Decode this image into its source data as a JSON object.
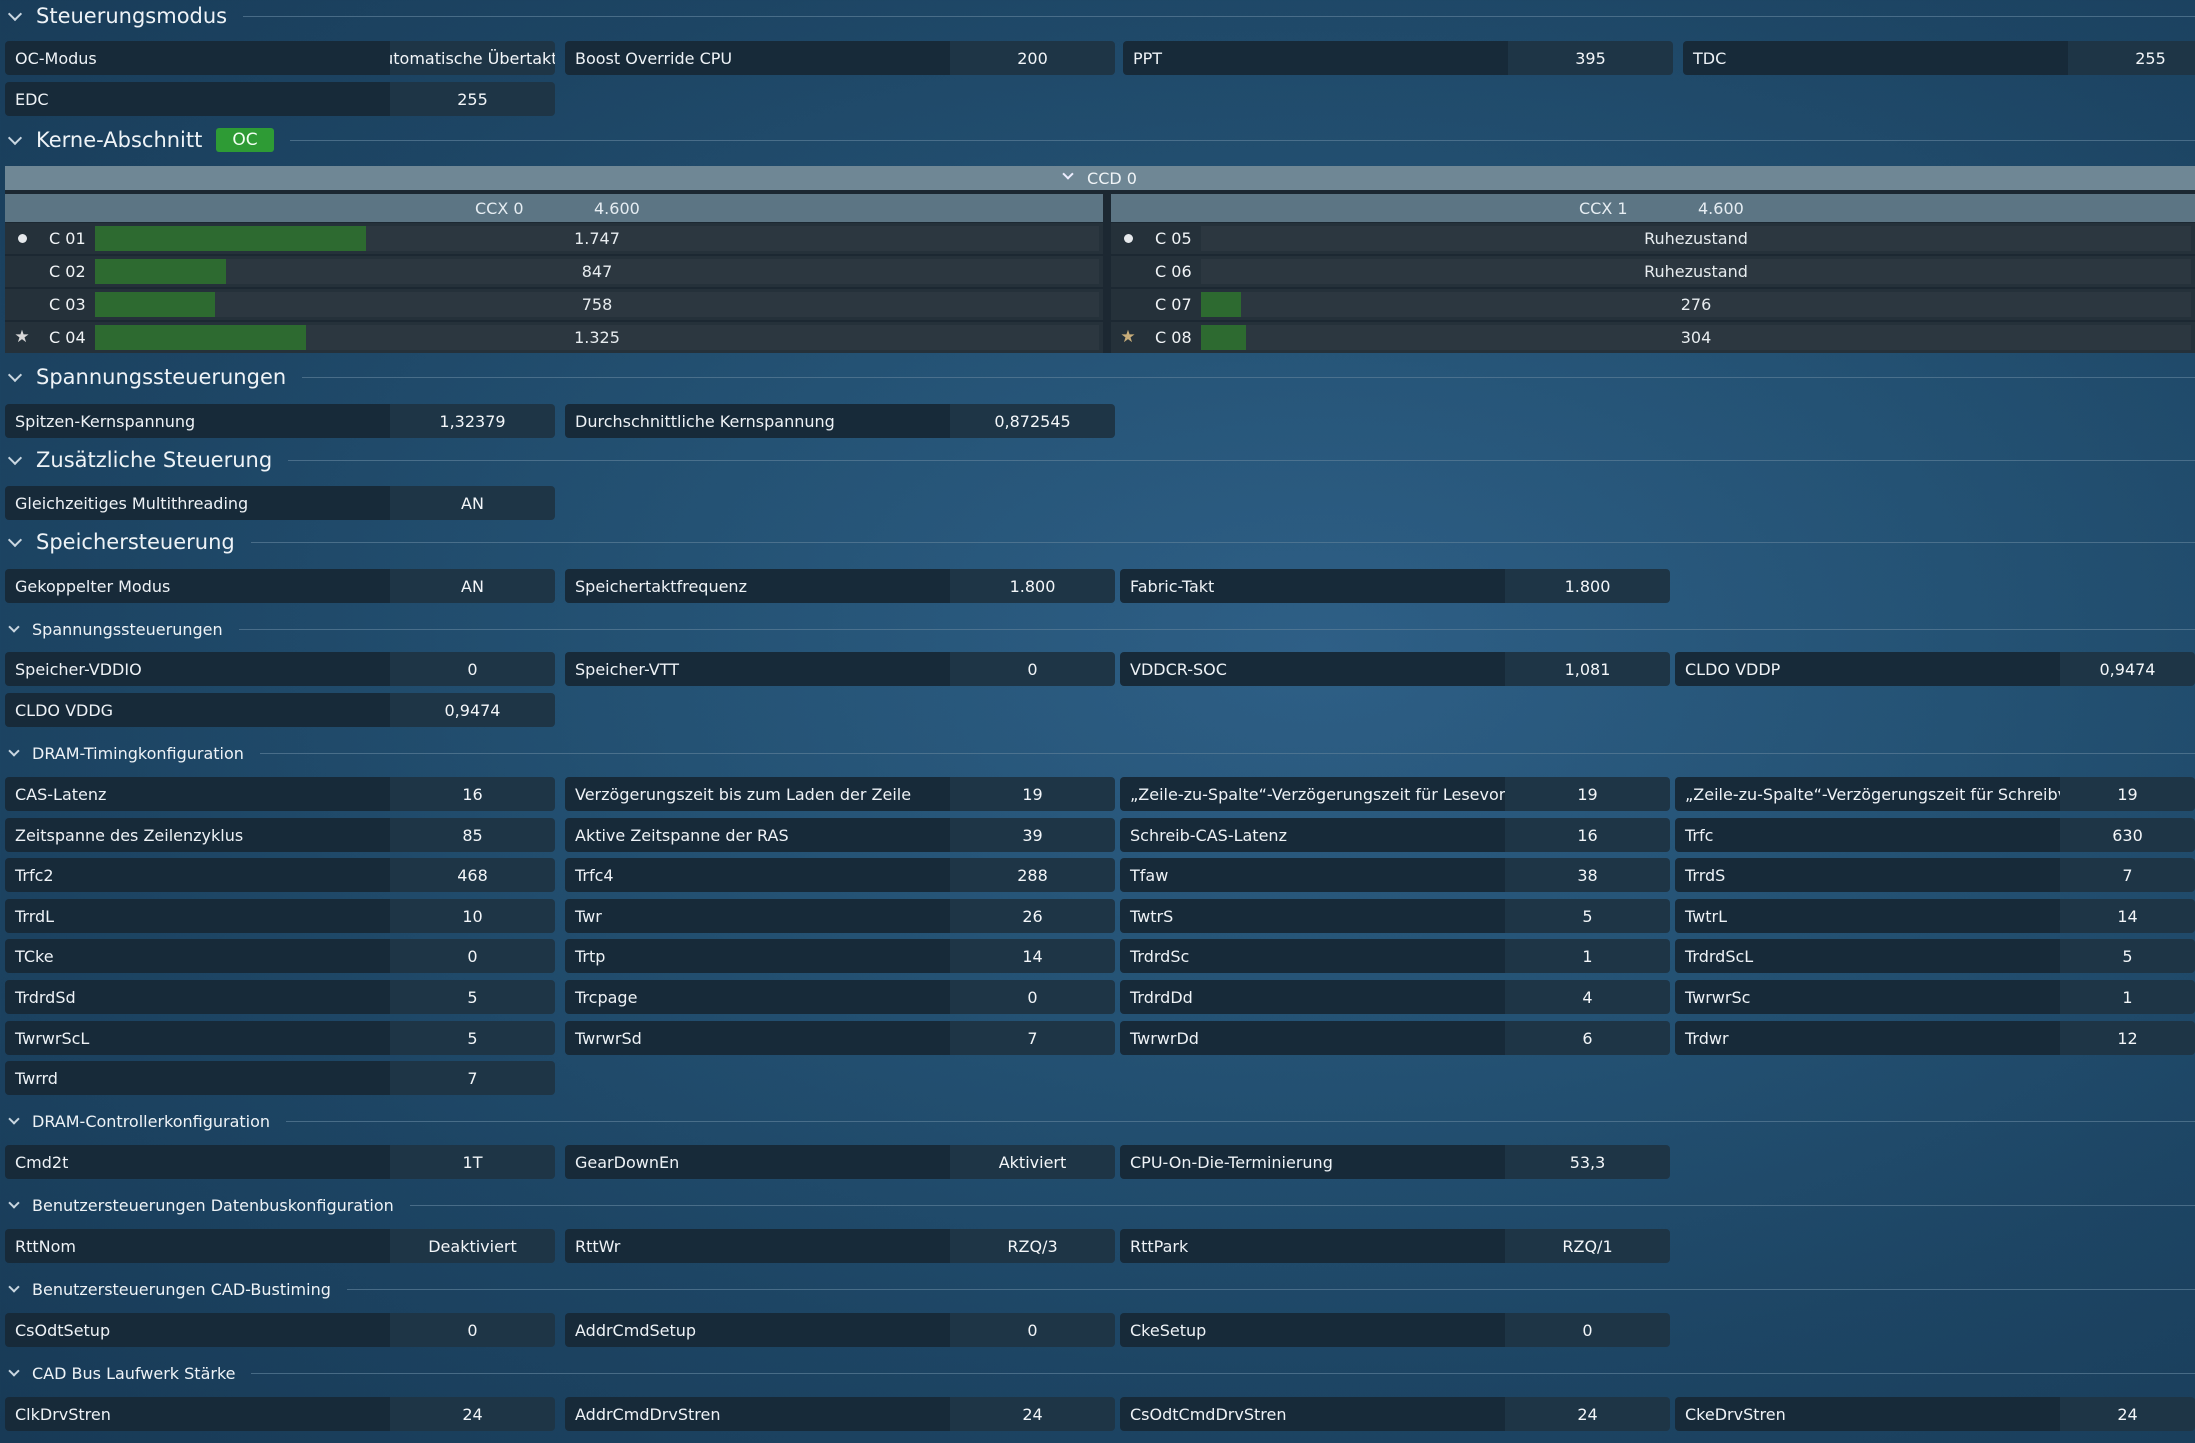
{
  "sections": {
    "steuerungsmodus": "Steuerungsmodus",
    "kerne": "Kerne-Abschnitt",
    "kerne_badge": "OC",
    "spannung": "Spannungssteuerungen",
    "zusaetzlich": "Zusätzliche Steuerung",
    "speicher": "Speichersteuerung",
    "sub_spannung": "Spannungssteuerungen",
    "sub_dram_timing": "DRAM-Timingkonfiguration",
    "sub_dram_ctrl": "DRAM-Controllerkonfiguration",
    "sub_datenbus": "Benutzersteuerungen Datenbuskonfiguration",
    "sub_cad_timing": "Benutzersteuerungen CAD-Bustiming",
    "sub_cad_strength": "CAD Bus Laufwerk Stärke"
  },
  "steuerung": [
    {
      "label": "OC-Modus",
      "value": "Automatische Übertakt..."
    },
    {
      "label": "Boost Override CPU",
      "value": "200"
    },
    {
      "label": "PPT",
      "value": "395"
    },
    {
      "label": "TDC",
      "value": "255"
    },
    {
      "label": "EDC",
      "value": "255"
    }
  ],
  "ccd": {
    "label": "CCD 0",
    "ccx0": {
      "label": "CCX 0",
      "freq": "4.600"
    },
    "ccx1": {
      "label": "CCX 1",
      "freq": "4.600"
    },
    "cores_left": [
      {
        "name": "C 01",
        "value": "1.747",
        "marker": "dot",
        "level": 0.27
      },
      {
        "name": "C 02",
        "value": "847",
        "marker": "none",
        "level": 0.13
      },
      {
        "name": "C 03",
        "value": "758",
        "marker": "none",
        "level": 0.12
      },
      {
        "name": "C 04",
        "value": "1.325",
        "marker": "star",
        "level": 0.21
      }
    ],
    "cores_right": [
      {
        "name": "C 05",
        "value": "Ruhezustand",
        "marker": "dot",
        "level": 0
      },
      {
        "name": "C 06",
        "value": "Ruhezustand",
        "marker": "none",
        "level": 0
      },
      {
        "name": "C 07",
        "value": "276",
        "marker": "none",
        "level": 0.04
      },
      {
        "name": "C 08",
        "value": "304",
        "marker": "star-gold",
        "level": 0.045
      }
    ]
  },
  "spannung": [
    {
      "label": "Spitzen-Kernspannung",
      "value": "1,32379"
    },
    {
      "label": "Durchschnittliche Kernspannung",
      "value": "0,872545"
    }
  ],
  "zusaetzlich": [
    {
      "label": "Gleichzeitiges Multithreading",
      "value": "AN"
    }
  ],
  "speicher": [
    {
      "label": "Gekoppelter Modus",
      "value": "AN"
    },
    {
      "label": "Speichertaktfrequenz",
      "value": "1.800"
    },
    {
      "label": "Fabric-Takt",
      "value": "1.800"
    }
  ],
  "mem_volt": [
    {
      "label": "Speicher-VDDIO",
      "value": "0"
    },
    {
      "label": "Speicher-VTT",
      "value": "0"
    },
    {
      "label": "VDDCR-SOC",
      "value": "1,081"
    },
    {
      "label": "CLDO VDDP",
      "value": "0,9474"
    },
    {
      "label": "CLDO VDDG",
      "value": "0,9474"
    }
  ],
  "dram_timing": [
    {
      "label": "CAS-Latenz",
      "value": "16"
    },
    {
      "label": "Verzögerungszeit bis zum Laden der Zeile",
      "value": "19"
    },
    {
      "label": "„Zeile-zu-Spalte“-Verzögerungszeit für Lesevorgang",
      "value": "19"
    },
    {
      "label": "„Zeile-zu-Spalte“-Verzögerungszeit für Schreibvor...",
      "value": "19"
    },
    {
      "label": "Zeitspanne des Zeilenzyklus",
      "value": "85"
    },
    {
      "label": "Aktive Zeitspanne der RAS",
      "value": "39"
    },
    {
      "label": "Schreib-CAS-Latenz",
      "value": "16"
    },
    {
      "label": "Trfc",
      "value": "630"
    },
    {
      "label": "Trfc2",
      "value": "468"
    },
    {
      "label": "Trfc4",
      "value": "288"
    },
    {
      "label": "Tfaw",
      "value": "38"
    },
    {
      "label": "TrrdS",
      "value": "7"
    },
    {
      "label": "TrrdL",
      "value": "10"
    },
    {
      "label": "Twr",
      "value": "26"
    },
    {
      "label": "TwtrS",
      "value": "5"
    },
    {
      "label": "TwtrL",
      "value": "14"
    },
    {
      "label": "TCke",
      "value": "0"
    },
    {
      "label": "Trtp",
      "value": "14"
    },
    {
      "label": "TrdrdSc",
      "value": "1"
    },
    {
      "label": "TrdrdScL",
      "value": "5"
    },
    {
      "label": "TrdrdSd",
      "value": "5"
    },
    {
      "label": "Trcpage",
      "value": "0"
    },
    {
      "label": "TrdrdDd",
      "value": "4"
    },
    {
      "label": "TwrwrSc",
      "value": "1"
    },
    {
      "label": "TwrwrScL",
      "value": "5"
    },
    {
      "label": "TwrwrSd",
      "value": "7"
    },
    {
      "label": "TwrwrDd",
      "value": "6"
    },
    {
      "label": "Trdwr",
      "value": "12"
    },
    {
      "label": "Twrrd",
      "value": "7"
    }
  ],
  "dram_ctrl": [
    {
      "label": "Cmd2t",
      "value": "1T"
    },
    {
      "label": "GearDownEn",
      "value": "Aktiviert"
    },
    {
      "label": "CPU-On-Die-Terminierung",
      "value": "53,3"
    }
  ],
  "datenbus": [
    {
      "label": "RttNom",
      "value": "Deaktiviert"
    },
    {
      "label": "RttWr",
      "value": "RZQ/3"
    },
    {
      "label": "RttPark",
      "value": "RZQ/1"
    }
  ],
  "cad_timing": [
    {
      "label": "CsOdtSetup",
      "value": "0"
    },
    {
      "label": "AddrCmdSetup",
      "value": "0"
    },
    {
      "label": "CkeSetup",
      "value": "0"
    }
  ],
  "cad_strength": [
    {
      "label": "ClkDrvStren",
      "value": "24"
    },
    {
      "label": "AddrCmdDrvStren",
      "value": "24"
    },
    {
      "label": "CsOdtCmdDrvStren",
      "value": "24"
    },
    {
      "label": "CkeDrvStren",
      "value": "24"
    }
  ],
  "colors": {
    "background": "#245274",
    "field_label_bg": "#172a39",
    "field_value_bg": "#1e3546",
    "badge": "#2e9b35",
    "core_bar": "#2d6a30"
  }
}
